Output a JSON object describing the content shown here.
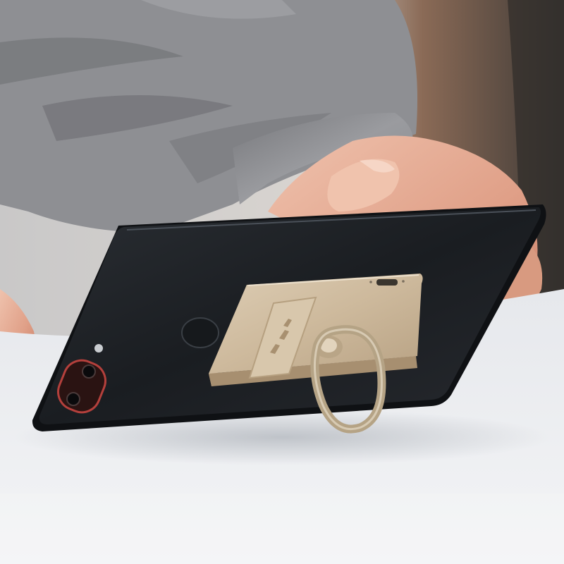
{
  "scene": {
    "subject": "phone-with-ring-holder-power-bank",
    "colors": {
      "sweater": "#8e8f93",
      "sweater_shadow": "#5d5e62",
      "skin": "#e3a58b",
      "table": "#eceef1",
      "phone_body": "#1b1e22",
      "accessory_gold": "#cdbb9f",
      "camera_ring": "#b4403c"
    }
  }
}
